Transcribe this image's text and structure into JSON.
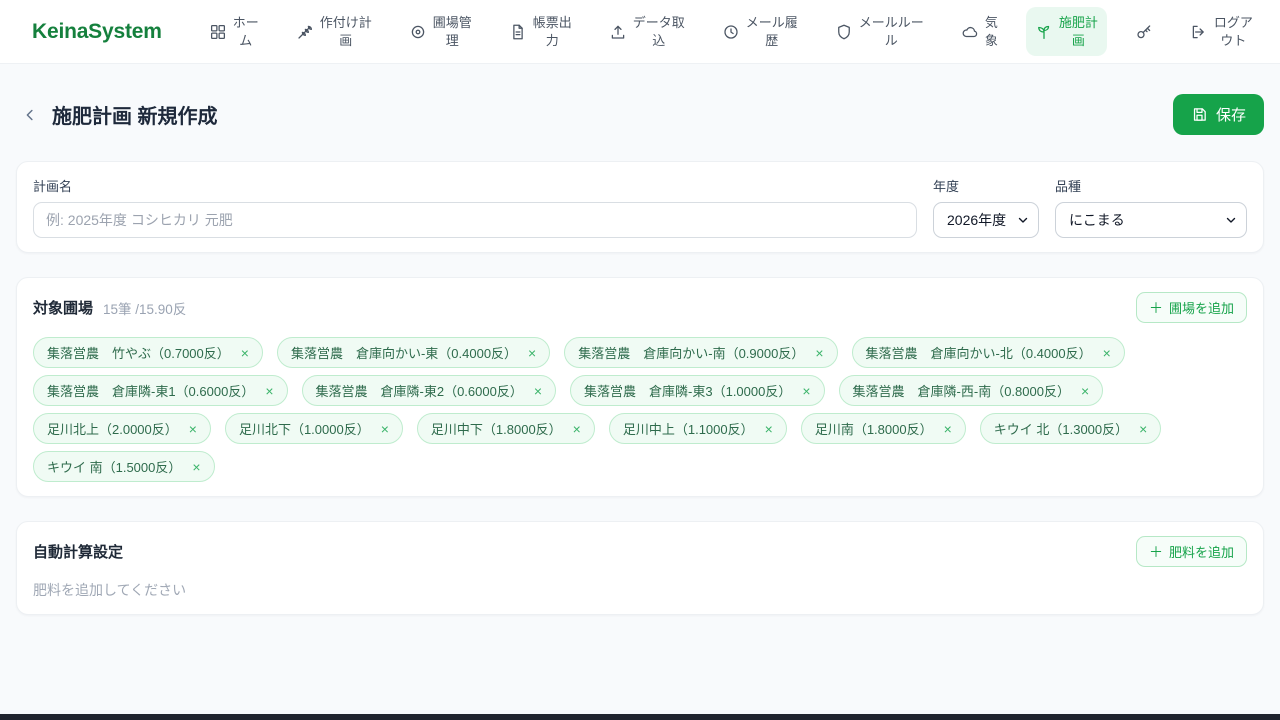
{
  "brand": "KeinaSystem",
  "colors": {
    "accent_green": "#16a34a",
    "brand_green": "#15803d",
    "chip_bg": "#f0fbf4",
    "chip_border": "#bfecce",
    "page_bg": "#f8fafc"
  },
  "nav": {
    "items": [
      {
        "id": "home",
        "label": "ホー\nム",
        "icon": "grid-icon",
        "active": false
      },
      {
        "id": "cropping-plan",
        "label": "作付け計\n画",
        "icon": "wheat-icon",
        "active": false
      },
      {
        "id": "field-mgmt",
        "label": "圃場管\n理",
        "icon": "map-pin-icon",
        "active": false
      },
      {
        "id": "report-output",
        "label": "帳票出\n力",
        "icon": "file-icon",
        "active": false
      },
      {
        "id": "data-import",
        "label": "データ取\n込",
        "icon": "upload-icon",
        "active": false
      },
      {
        "id": "mail-history",
        "label": "メール履\n歴",
        "icon": "history-icon",
        "active": false
      },
      {
        "id": "mail-rules",
        "label": "メールルー\nル",
        "icon": "shield-icon",
        "active": false
      },
      {
        "id": "weather",
        "label": "気\n象",
        "icon": "cloud-icon",
        "active": false
      },
      {
        "id": "fertilization",
        "label": "施肥計\n画",
        "icon": "sprout-icon",
        "active": true
      },
      {
        "id": "key",
        "label": "",
        "icon": "key-icon",
        "active": false
      },
      {
        "id": "logout",
        "label": "ログア\nウト",
        "icon": "logout-icon",
        "active": false
      }
    ]
  },
  "header": {
    "title": "施肥計画 新規作成",
    "save_label": "保存"
  },
  "form": {
    "plan_name_label": "計画名",
    "plan_name_value": "",
    "plan_name_placeholder": "例: 2025年度 コシヒカリ 元肥",
    "year_label": "年度",
    "year_value": "2026年度",
    "variety_label": "品種",
    "variety_value": "にこまる"
  },
  "fields_section": {
    "title": "対象圃場",
    "summary": "15筆 /15.90反",
    "add_button_label": "圃場を追加",
    "plus_glyph": "＋",
    "remove_glyph": "×",
    "chips": [
      {
        "label": "集落営農　竹やぶ（0.7000反）"
      },
      {
        "label": "集落営農　倉庫向かい-東（0.4000反）"
      },
      {
        "label": "集落営農　倉庫向かい-南（0.9000反）"
      },
      {
        "label": "集落営農　倉庫向かい-北（0.4000反）"
      },
      {
        "label": "集落営農　倉庫隣-東1（0.6000反）"
      },
      {
        "label": "集落営農　倉庫隣-東2（0.6000反）"
      },
      {
        "label": "集落営農　倉庫隣-東3（1.0000反）"
      },
      {
        "label": "集落営農　倉庫隣-西-南（0.8000反）"
      },
      {
        "label": "足川北上（2.0000反）"
      },
      {
        "label": "足川北下（1.0000反）"
      },
      {
        "label": "足川中下（1.8000反）"
      },
      {
        "label": "足川中上（1.1000反）"
      },
      {
        "label": "足川南（1.8000反）"
      },
      {
        "label": "キウイ 北（1.3000反）"
      },
      {
        "label": "キウイ 南（1.5000反）"
      }
    ]
  },
  "fertilizer_section": {
    "title": "自動計算設定",
    "add_button_label": "肥料を追加",
    "plus_glyph": "＋",
    "empty_text": "肥料を追加してください"
  }
}
